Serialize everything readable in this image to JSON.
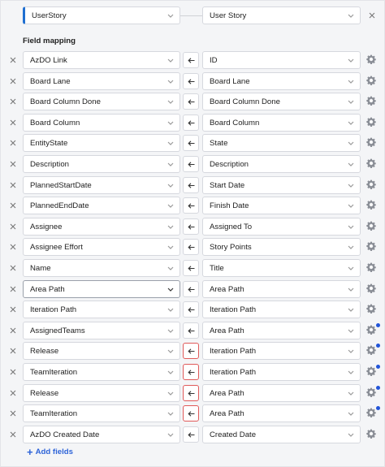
{
  "header": {
    "source_type": "UserStory",
    "target_type": "User Story"
  },
  "section_title": "Field mapping",
  "mappings": [
    {
      "source": "AzDO Link",
      "target": "ID",
      "dot": false,
      "highlight": false,
      "active": false
    },
    {
      "source": "Board Lane",
      "target": "Board Lane",
      "dot": false,
      "highlight": false,
      "active": false
    },
    {
      "source": "Board Column Done",
      "target": "Board Column Done",
      "dot": false,
      "highlight": false,
      "active": false
    },
    {
      "source": "Board Column",
      "target": "Board Column",
      "dot": false,
      "highlight": false,
      "active": false
    },
    {
      "source": "EntityState",
      "target": "State",
      "dot": false,
      "highlight": false,
      "active": false
    },
    {
      "source": "Description",
      "target": "Description",
      "dot": false,
      "highlight": false,
      "active": false
    },
    {
      "source": "PlannedStartDate",
      "target": "Start Date",
      "dot": false,
      "highlight": false,
      "active": false
    },
    {
      "source": "PlannedEndDate",
      "target": "Finish Date",
      "dot": false,
      "highlight": false,
      "active": false
    },
    {
      "source": "Assignee",
      "target": "Assigned To",
      "dot": false,
      "highlight": false,
      "active": false
    },
    {
      "source": "Assignee Effort",
      "target": "Story Points",
      "dot": false,
      "highlight": false,
      "active": false
    },
    {
      "source": "Name",
      "target": "Title",
      "dot": false,
      "highlight": false,
      "active": false
    },
    {
      "source": "Area Path",
      "target": "Area Path",
      "dot": false,
      "highlight": false,
      "active": true
    },
    {
      "source": "Iteration Path",
      "target": "Iteration Path",
      "dot": false,
      "highlight": false,
      "active": false
    },
    {
      "source": "AssignedTeams",
      "target": "Area Path",
      "dot": true,
      "highlight": false,
      "active": false
    },
    {
      "source": "Release",
      "target": "Iteration Path",
      "dot": true,
      "highlight": true,
      "active": false
    },
    {
      "source": "TeamIteration",
      "target": "Iteration Path",
      "dot": true,
      "highlight": true,
      "active": false
    },
    {
      "source": "Release",
      "target": "Area Path",
      "dot": true,
      "highlight": true,
      "active": false
    },
    {
      "source": "TeamIteration",
      "target": "Area Path",
      "dot": true,
      "highlight": true,
      "active": false
    },
    {
      "source": "AzDO Created Date",
      "target": "Created Date",
      "dot": false,
      "highlight": false,
      "active": false
    }
  ],
  "add_fields_label": "Add fields",
  "colors": {
    "accent": "#1f6fd1",
    "link": "#2d63d8",
    "highlight": "#e05a5a",
    "dot": "#2255d8"
  },
  "icons": {
    "remove": "close-icon",
    "direction": "arrow-left-icon",
    "settings": "gear-icon",
    "dropdown": "chevron-down-icon",
    "add": "plus-icon"
  }
}
